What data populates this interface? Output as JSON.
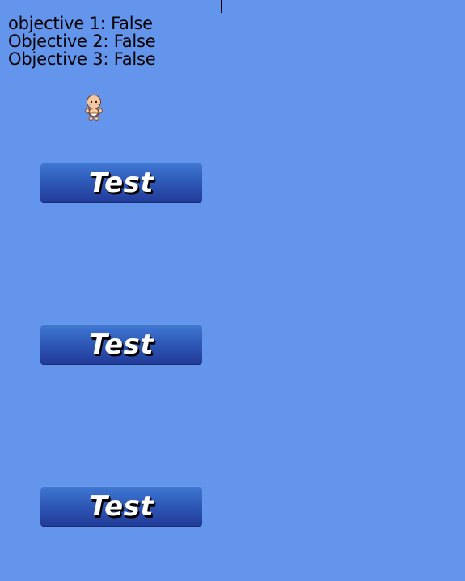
{
  "objectives": [
    "objective 1: False",
    "Objective 2: False",
    "Objective 3: False"
  ],
  "character": {
    "icon": "baby-character-icon"
  },
  "buttons": [
    {
      "label": "Test"
    },
    {
      "label": "Test"
    },
    {
      "label": "Test"
    }
  ],
  "colors": {
    "background": "#6495ED",
    "button_top": "#3f79d4",
    "button_bottom": "#223a98",
    "button_text": "#ffffff"
  }
}
